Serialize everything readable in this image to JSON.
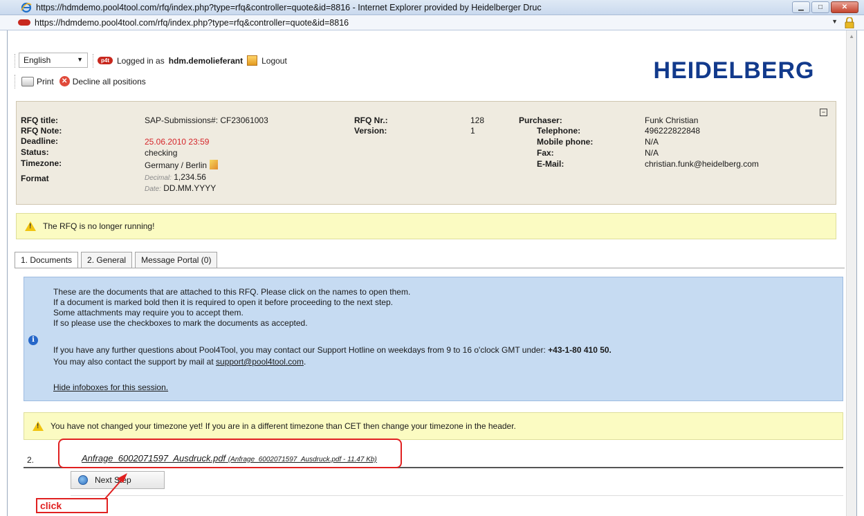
{
  "window": {
    "title": "https://hdmdemo.pool4tool.com/rfq/index.php?type=rfq&controller=quote&id=8816 - Internet Explorer provided by Heidelberger Druc",
    "address": "https://hdmdemo.pool4tool.com/rfq/index.php?type=rfq&controller=quote&id=8816"
  },
  "header": {
    "language": "English",
    "logged_in_prefix": "Logged in as",
    "username": "hdm.demolieferant",
    "logout": "Logout",
    "print": "Print",
    "decline": "Decline all positions",
    "logo": "HEIDELBERG"
  },
  "rfq": {
    "labels": {
      "title": "RFQ title:",
      "note": "RFQ Note:",
      "deadline": "Deadline:",
      "status": "Status:",
      "timezone": "Timezone:",
      "format": "Format",
      "nr": "RFQ Nr.:",
      "version": "Version:",
      "purchaser": "Purchaser:",
      "telephone": "Telephone:",
      "mobile": "Mobile phone:",
      "fax": "Fax:",
      "email": "E-Mail:"
    },
    "values": {
      "title": "SAP-Submissions#: CF23061003",
      "deadline": "25.06.2010 23:59",
      "status": "checking",
      "timezone": "Germany / Berlin",
      "decimal_label": "Decimal:",
      "decimal_value": "1,234.56",
      "date_label": "Date:",
      "date_value": "DD.MM.YYYY",
      "nr": "128",
      "version": "1",
      "purchaser": "Funk Christian",
      "telephone": "496222822848",
      "mobile": "N/A",
      "fax": "N/A",
      "email": "christian.funk@heidelberg.com"
    }
  },
  "warning1": "The RFQ is no longer running!",
  "tabs": [
    "1. Documents",
    "2. General",
    "Message Portal (0)"
  ],
  "info": {
    "line1": "These are the documents that are attached to this RFQ. Please click on the names to open them.",
    "line2": "If a document is marked bold then it is required to open it before proceeding to the next step.",
    "line3": "Some attachments may require you to accept them.",
    "line4": "If so please use the checkboxes to mark the documents as accepted.",
    "support_text": "If you have any further questions about Pool4Tool, you may contact our Support Hotline on weekdays from 9 to 16 o'clock GMT under:",
    "support_phone": "+43-1-80 410 50.",
    "mail_text": "You may also contact the support by mail at",
    "mail_link": "support@pool4tool.com",
    "hide": "Hide infoboxes for this session."
  },
  "warning2": "You have not changed your timezone yet! If you are in a different timezone than CET then change your timezone in the header.",
  "document": {
    "number": "2.",
    "name": "Anfrage_6002071597_Ausdruck.pdf",
    "meta": "(Anfrage_6002071597_Ausdruck.pdf - 11.47 Kb)"
  },
  "next_step": "Next Step",
  "annotation": "click",
  "colors": {
    "deadline": "#d5252a",
    "annotation": "#e02020",
    "info_bg": "#c6dbf2",
    "warn_bg": "#fbfbc2",
    "rfq_bg": "#efebe0"
  }
}
